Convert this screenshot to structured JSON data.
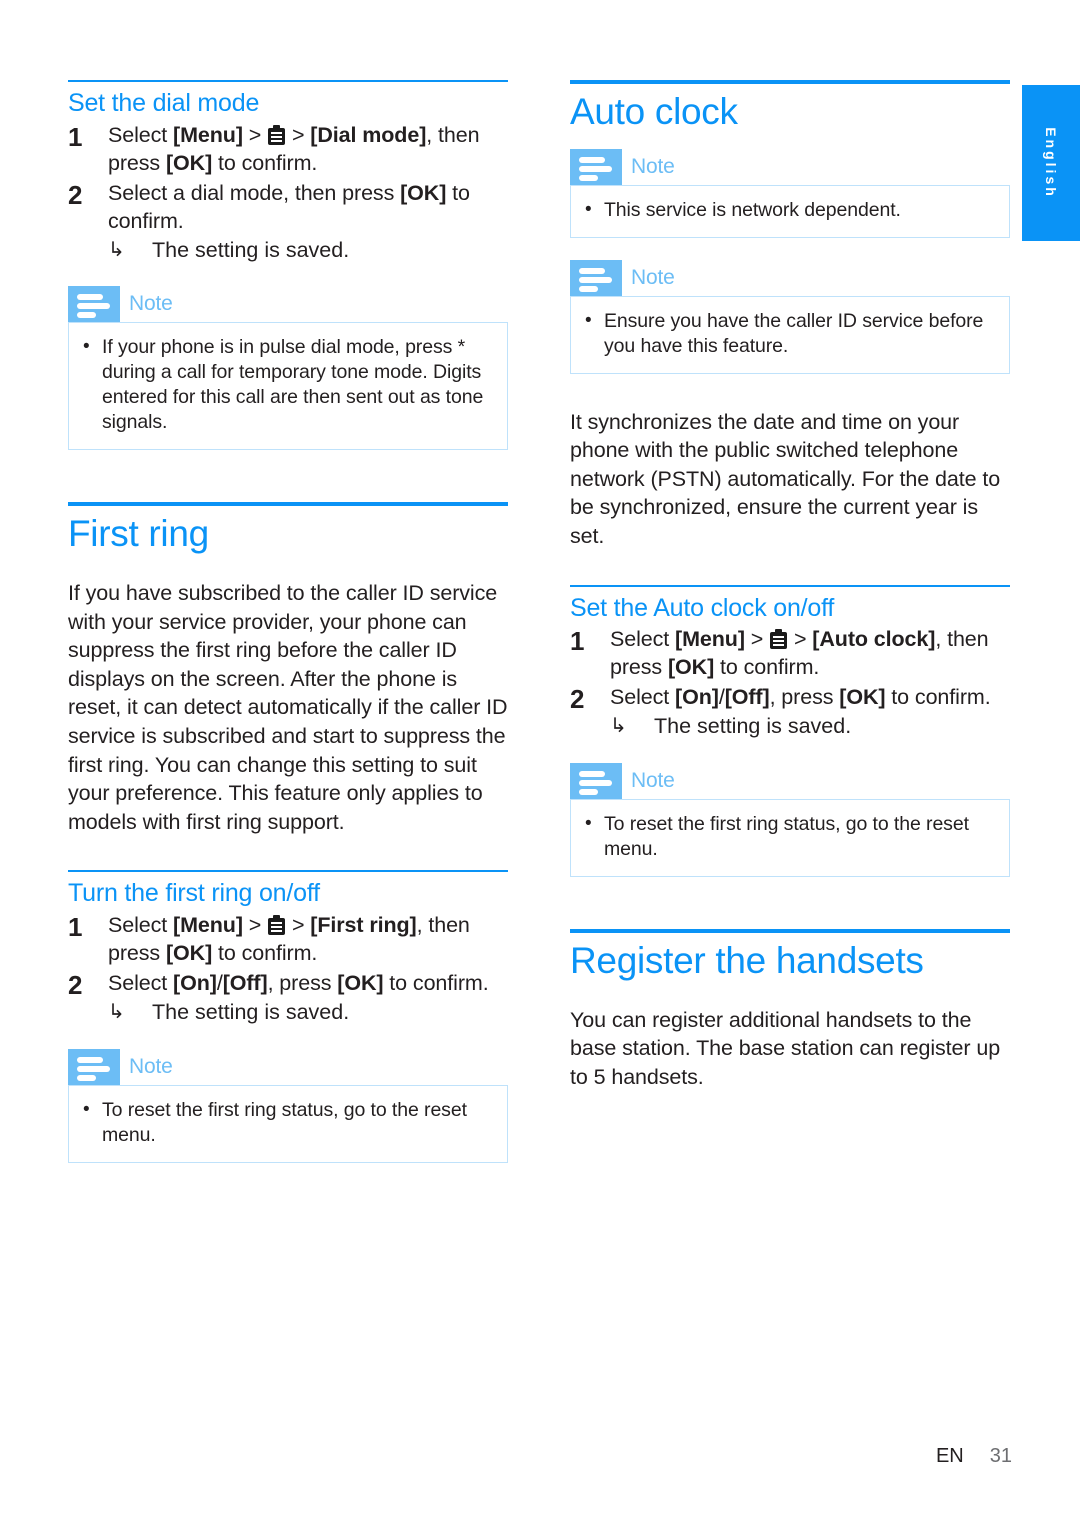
{
  "language_tab": {
    "label": "English"
  },
  "footer": {
    "locale": "EN",
    "page_number": "31"
  },
  "icons": {
    "menu_icon": "clipboard-menu-icon",
    "note_icon": "note-lines-icon",
    "arrow_glyph": "↳",
    "bullet_glyph": "•"
  },
  "left_column": {
    "dial_mode": {
      "heading": "Set the dial mode",
      "steps": [
        {
          "number": "1",
          "parts": [
            {
              "t": "Select ",
              "b": false
            },
            {
              "t": "[Menu]",
              "b": true
            },
            {
              "t": " > ",
              "b": false
            },
            {
              "t": "ICON",
              "b": false
            },
            {
              "t": " > ",
              "b": false
            },
            {
              "t": "[Dial mode]",
              "b": true
            },
            {
              "t": ", then press ",
              "b": false
            },
            {
              "t": "[OK]",
              "b": true
            },
            {
              "t": " to confirm.",
              "b": false
            }
          ]
        },
        {
          "number": "2",
          "parts": [
            {
              "t": "Select a dial mode, then press ",
              "b": false
            },
            {
              "t": "[OK]",
              "b": true
            },
            {
              "t": " to confirm.",
              "b": false
            }
          ],
          "substep": "The setting is saved."
        }
      ],
      "note": {
        "title": "Note",
        "items": [
          "If your phone is in pulse dial mode, press * during a call for temporary tone mode. Digits entered for this call are then sent out as tone signals."
        ]
      }
    },
    "first_ring": {
      "heading": "First ring",
      "body": "If you have subscribed to the caller ID service with your service provider, your phone can suppress the first ring before the caller ID displays on the screen. After the phone is reset, it can detect automatically if the caller ID service is subscribed and start to suppress the first ring. You can change this setting to suit your preference. This feature only applies to models with first ring support.",
      "sub": {
        "heading": "Turn the first ring on/off",
        "steps": [
          {
            "number": "1",
            "parts": [
              {
                "t": "Select ",
                "b": false
              },
              {
                "t": "[Menu]",
                "b": true
              },
              {
                "t": " > ",
                "b": false
              },
              {
                "t": "ICON",
                "b": false
              },
              {
                "t": " > ",
                "b": false
              },
              {
                "t": "[First ring]",
                "b": true
              },
              {
                "t": ", then press ",
                "b": false
              },
              {
                "t": "[OK]",
                "b": true
              },
              {
                "t": " to confirm.",
                "b": false
              }
            ]
          },
          {
            "number": "2",
            "parts": [
              {
                "t": "Select ",
                "b": false
              },
              {
                "t": "[On]",
                "b": true
              },
              {
                "t": "/",
                "b": false
              },
              {
                "t": "[Off]",
                "b": true
              },
              {
                "t": ", press ",
                "b": false
              },
              {
                "t": "[OK]",
                "b": true
              },
              {
                "t": " to confirm.",
                "b": false
              }
            ],
            "substep": "The setting is saved."
          }
        ],
        "note": {
          "title": "Note",
          "items": [
            "To reset the first ring status, go to the reset menu."
          ]
        }
      }
    }
  },
  "right_column": {
    "auto_clock": {
      "heading": "Auto clock",
      "note_1": {
        "title": "Note",
        "items": [
          "This service is network dependent."
        ]
      },
      "note_2": {
        "title": "Note",
        "items": [
          "Ensure you have the caller ID service before you have this feature."
        ]
      },
      "body": "It synchronizes the date and time on your phone with the public switched telephone network (PSTN) automatically. For the date to be synchronized, ensure the current year is set.",
      "sub": {
        "heading": "Set the Auto clock on/off",
        "steps": [
          {
            "number": "1",
            "parts": [
              {
                "t": "Select ",
                "b": false
              },
              {
                "t": "[Menu]",
                "b": true
              },
              {
                "t": " > ",
                "b": false
              },
              {
                "t": "ICON",
                "b": false
              },
              {
                "t": " > ",
                "b": false
              },
              {
                "t": "[Auto clock]",
                "b": true
              },
              {
                "t": ", then press ",
                "b": false
              },
              {
                "t": "[OK]",
                "b": true
              },
              {
                "t": " to confirm.",
                "b": false
              }
            ]
          },
          {
            "number": "2",
            "parts": [
              {
                "t": "Select ",
                "b": false
              },
              {
                "t": "[On]",
                "b": true
              },
              {
                "t": "/",
                "b": false
              },
              {
                "t": "[Off]",
                "b": true
              },
              {
                "t": ", press ",
                "b": false
              },
              {
                "t": "[OK]",
                "b": true
              },
              {
                "t": " to confirm.",
                "b": false
              }
            ],
            "substep": "The setting is saved."
          }
        ],
        "note": {
          "title": "Note",
          "items": [
            "To reset the first ring status, go to the reset menu."
          ]
        }
      }
    },
    "register_handsets": {
      "heading": "Register the handsets",
      "body": "You can register additional handsets to the base station. The base station can register up to 5 handsets."
    }
  },
  "colors": {
    "accent_blue": "#0a93f6",
    "note_blue": "#6cbdf5",
    "note_border": "#bfe2fb",
    "text": "#231f20"
  }
}
